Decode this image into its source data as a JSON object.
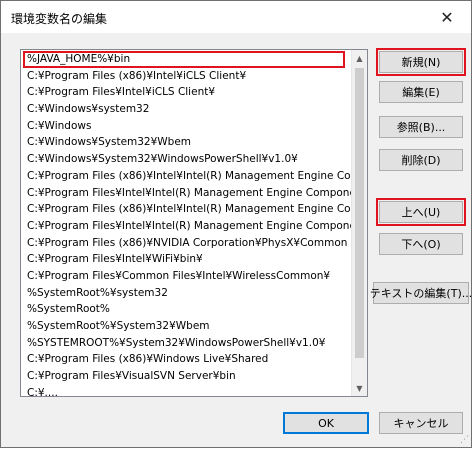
{
  "window": {
    "title": "環境変数名の編集",
    "close_glyph": "✕"
  },
  "list": {
    "editing_value": "%JAVA_HOME%¥bin",
    "items": [
      "C:¥Program Files (x86)¥Intel¥iCLS Client¥",
      "C:¥Program Files¥Intel¥iCLS Client¥",
      "C:¥Windows¥system32",
      "C:¥Windows",
      "C:¥Windows¥System32¥Wbem",
      "C:¥Windows¥System32¥WindowsPowerShell¥v1.0¥",
      "C:¥Program Files (x86)¥Intel¥Intel(R) Management Engine Compon...",
      "C:¥Program Files¥Intel¥Intel(R) Management Engine Components¥...",
      "C:¥Program Files (x86)¥Intel¥Intel(R) Management Engine Compon...",
      "C:¥Program Files¥Intel¥Intel(R) Management Engine Components¥...",
      "C:¥Program Files (x86)¥NVIDIA Corporation¥PhysX¥Common",
      "C:¥Program Files¥Intel¥WiFi¥bin¥",
      "C:¥Program Files¥Common Files¥Intel¥WirelessCommon¥",
      "%SystemRoot%¥system32",
      "%SystemRoot%",
      "%SystemRoot%¥System32¥Wbem",
      "%SYSTEMROOT%¥System32¥WindowsPowerShell¥v1.0¥",
      "C:¥Program Files (x86)¥Windows Live¥Shared",
      "C:¥Program Files¥VisualSVN Server¥bin",
      "C:¥...."
    ]
  },
  "buttons": {
    "new": "新規(N)",
    "edit": "編集(E)",
    "browse": "参照(B)...",
    "delete": "削除(D)",
    "move_up": "上へ(U)",
    "move_down": "下へ(O)",
    "edit_text": "テキストの編集(T)...",
    "ok": "OK",
    "cancel": "キャンセル"
  },
  "colors": {
    "highlight": "#e0141e",
    "default_button_border": "#0078d7"
  },
  "icons": {
    "close": "close-icon",
    "scroll_up": "scroll-up-arrow-icon",
    "scroll_down": "scroll-down-arrow-icon"
  }
}
